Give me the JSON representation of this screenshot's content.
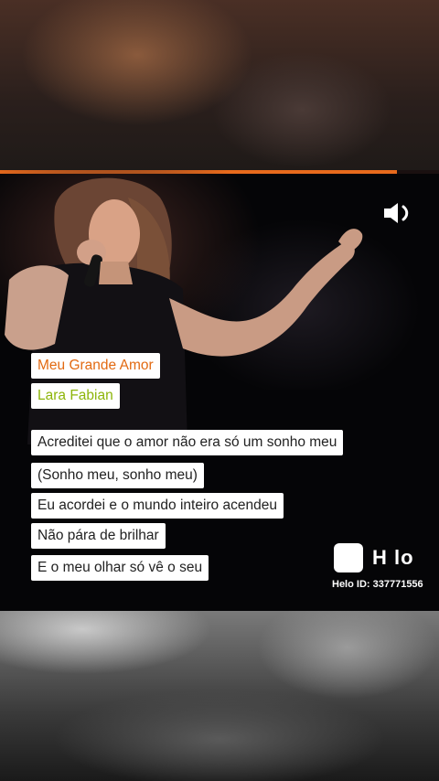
{
  "video": {
    "progress_fraction": 0.905,
    "song_title": "Meu Grande Amor",
    "artist": "Lara Fabian",
    "lyrics": [
      "Acreditei que o amor não era só um sonho meu",
      "(Sonho meu, sonho meu)",
      "Eu acordei e o mundo inteiro acendeu",
      "Não pára de brilhar",
      "E o meu olhar só vê o seu"
    ],
    "sound_icon": "speaker-volume-icon",
    "watermark": {
      "logo_text": "H lo",
      "id_text": "Helo ID: 337771556"
    }
  },
  "colors": {
    "accent": "#e86a1c",
    "title_color": "#e26a12",
    "artist_color": "#8db50a"
  }
}
